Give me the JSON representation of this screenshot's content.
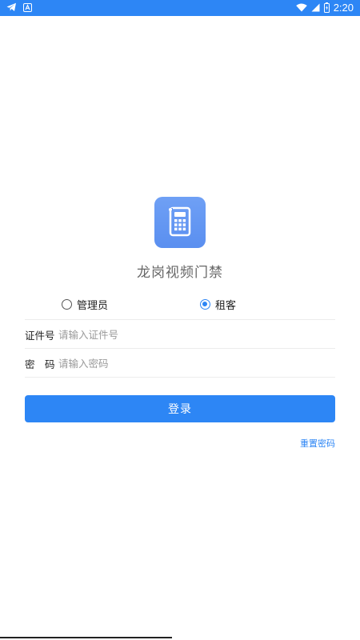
{
  "status_bar": {
    "time": "2:20",
    "left_icons": [
      "telegram-icon",
      "font-a-icon"
    ],
    "right_icons": [
      "wifi-icon",
      "signal-icon",
      "battery-icon"
    ],
    "background": "#2d86f5"
  },
  "app": {
    "title": "龙岗视频门禁",
    "logo_icon": "calculator-icon"
  },
  "roles": {
    "admin_label": "管理员",
    "tenant_label": "租客",
    "selected": "tenant"
  },
  "form": {
    "id_label": "证件号",
    "id_placeholder": "请输入证件号",
    "id_value": "",
    "password_label": "密　码",
    "password_placeholder": "请输入密码",
    "password_value": ""
  },
  "actions": {
    "login_label": "登录",
    "reset_label": "重置密码"
  },
  "colors": {
    "accent": "#2d86f5"
  }
}
